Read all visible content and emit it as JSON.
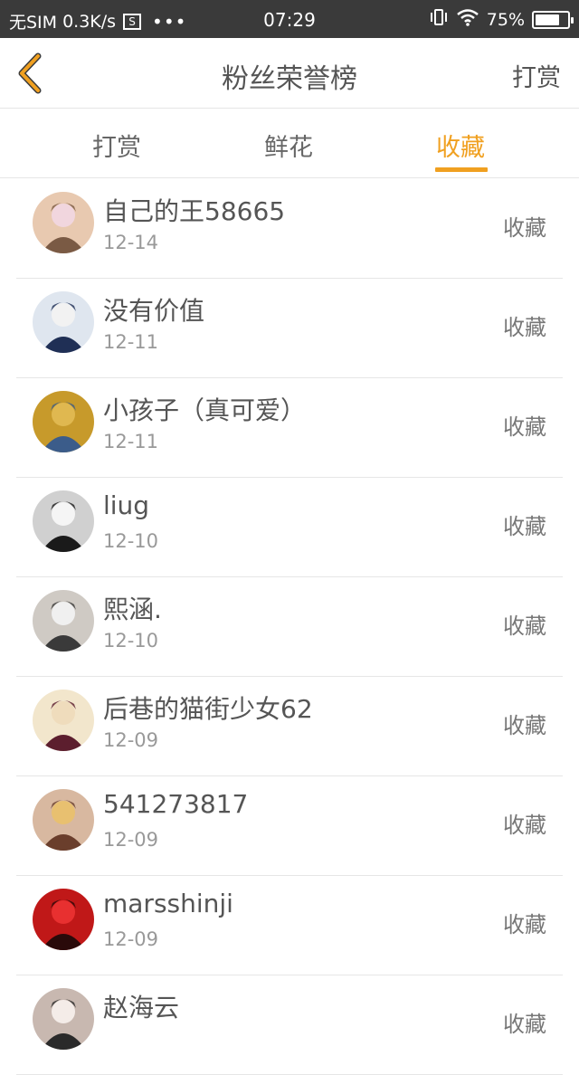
{
  "statusbar": {
    "carrier": "无SIM",
    "speed": "0.3K/s",
    "sim_icon_label": "S",
    "dots": "•••",
    "time": "07:29",
    "battery": "75%",
    "battery_level": 0.75
  },
  "navbar": {
    "title": "粉丝荣誉榜",
    "action": "打赏",
    "back_icon": "chevron-left-icon",
    "back_color": "#f0a020"
  },
  "tabs": [
    {
      "label": "打赏",
      "active": false
    },
    {
      "label": "鲜花",
      "active": false
    },
    {
      "label": "收藏",
      "active": true
    }
  ],
  "accent_color": "#f0a020",
  "rows": [
    {
      "name": "自己的王58665",
      "date": "12-14",
      "type": "收藏",
      "avatar_colors": [
        "#e8c9b0",
        "#7a5a44",
        "#f1d6de"
      ]
    },
    {
      "name": "没有价值",
      "date": "12-11",
      "type": "收藏",
      "avatar_colors": [
        "#dfe6ef",
        "#1f2f55",
        "#f2f2f2"
      ]
    },
    {
      "name": "小孩子（真可爱）",
      "date": "12-11",
      "type": "收藏",
      "avatar_colors": [
        "#c79a2b",
        "#3b5c8a",
        "#e0b850"
      ]
    },
    {
      "name": "liug",
      "date": "12-10",
      "type": "收藏",
      "avatar_colors": [
        "#d0d0d0",
        "#1a1a1a",
        "#f5f5f5"
      ]
    },
    {
      "name": "熙涵.",
      "date": "12-10",
      "type": "收藏",
      "avatar_colors": [
        "#cfcac4",
        "#3a3a3a",
        "#f0f0f0"
      ]
    },
    {
      "name": "后巷的猫街少女62",
      "date": "12-09",
      "type": "收藏",
      "avatar_colors": [
        "#f2e6cc",
        "#5c1e2e",
        "#efdcbc"
      ]
    },
    {
      "name": "541273817",
      "date": "12-09",
      "type": "收藏",
      "avatar_colors": [
        "#d8b8a0",
        "#6a3e2c",
        "#e8c070"
      ]
    },
    {
      "name": "marsshinji",
      "date": "12-09",
      "type": "收藏",
      "avatar_colors": [
        "#c01818",
        "#2a0a0a",
        "#e83030"
      ]
    },
    {
      "name": "赵海云",
      "date": "",
      "type": "收藏",
      "avatar_colors": [
        "#c8b8b0",
        "#2a2a2a",
        "#f4ece8"
      ]
    }
  ]
}
